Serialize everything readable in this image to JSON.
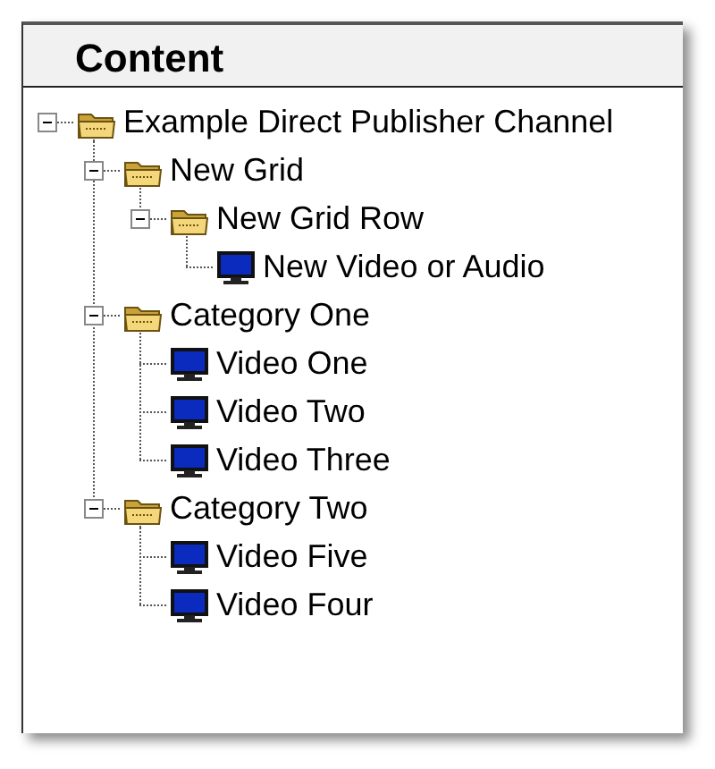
{
  "panel": {
    "title": "Content"
  },
  "tree": [
    {
      "label": "Example Direct Publisher Channel",
      "kind": "folder",
      "expanded": true,
      "children": [
        {
          "label": "New Grid",
          "kind": "folder",
          "expanded": true,
          "children": [
            {
              "label": "New Grid Row",
              "kind": "folder",
              "expanded": true,
              "children": [
                {
                  "label": "New Video or Audio",
                  "kind": "video"
                }
              ]
            }
          ]
        },
        {
          "label": "Category One",
          "kind": "folder",
          "expanded": true,
          "children": [
            {
              "label": "Video One",
              "kind": "video"
            },
            {
              "label": "Video Two",
              "kind": "video"
            },
            {
              "label": "Video Three",
              "kind": "video"
            }
          ]
        },
        {
          "label": "Category Two",
          "kind": "folder",
          "expanded": true,
          "children": [
            {
              "label": "Video Five",
              "kind": "video"
            },
            {
              "label": "Video Four",
              "kind": "video"
            }
          ]
        }
      ]
    }
  ]
}
